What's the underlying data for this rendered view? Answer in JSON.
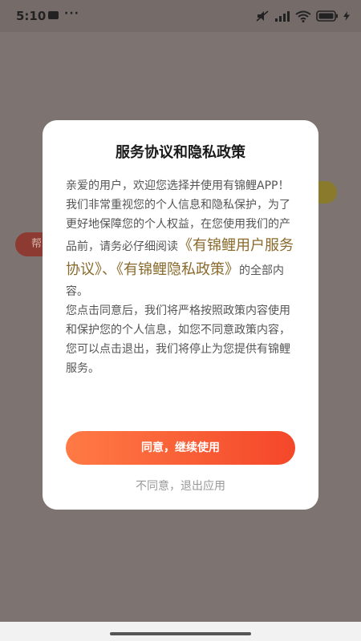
{
  "status_bar": {
    "time": "5:10",
    "more": "···",
    "icons": [
      "message-icon",
      "silent-icon",
      "signal-icon",
      "wifi-icon",
      "battery-icon",
      "charging-icon"
    ]
  },
  "background": {
    "red_pill_label": "帮"
  },
  "dialog": {
    "title": "服务协议和隐私政策",
    "greeting": "亲爱的用户，欢迎您选择并使用有锦鲤APP！",
    "para1_prefix": "我们非常重视您的个人信息和隐私保护，为了更好地保障您的个人权益，在您使用我们的产品前，请务必仔细阅读",
    "agreement_link": "《有锦鲤用户服务协议》",
    "separator": "、",
    "privacy_link": "《有锦鲤隐私政策》",
    "para1_suffix": "的全部内容。",
    "para2": "您点击同意后，我们将严格按照政策内容使用和保护您的个人信息，如您不同意政策内容，您可以点击退出，我们将停止为您提供有锦鲤服务。",
    "agree_label": "同意，继续使用",
    "disagree_label": "不同意，退出应用"
  },
  "colors": {
    "primary_gradient_start": "#ff7a45",
    "primary_gradient_end": "#f4472a",
    "link": "#8a6a2c",
    "overlay": "#7d7371"
  }
}
